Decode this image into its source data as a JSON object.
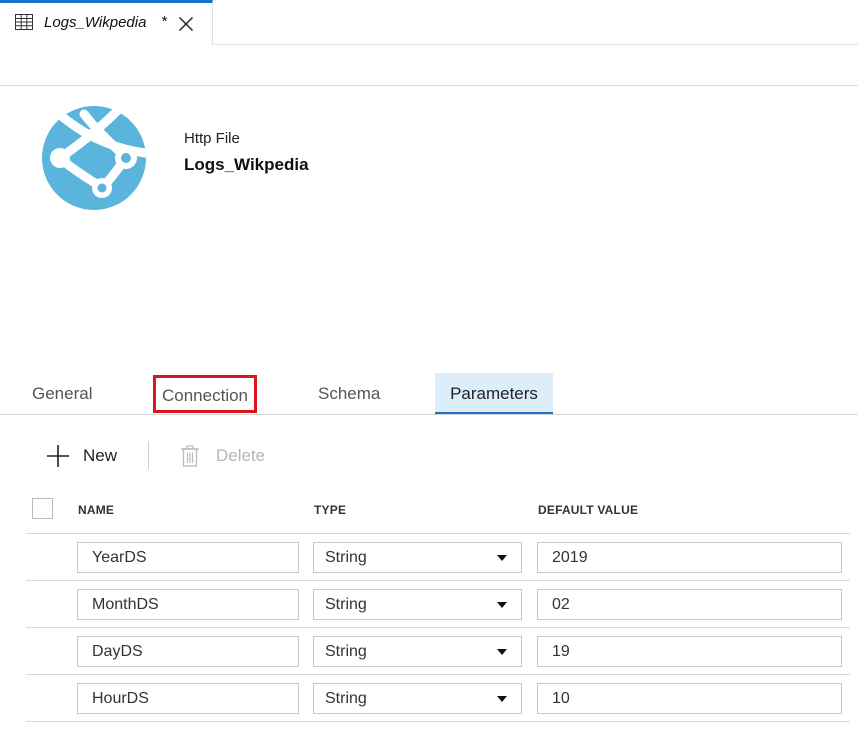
{
  "document_tab": {
    "title": "Logs_Wikpedia",
    "dirty_marker": "*"
  },
  "header": {
    "type_label": "Http File",
    "dataset_name": "Logs_Wikpedia"
  },
  "tabs": [
    {
      "label": "General"
    },
    {
      "label": "Connection"
    },
    {
      "label": "Schema"
    },
    {
      "label": "Parameters"
    }
  ],
  "active_tab": "Parameters",
  "highlighted_tab": "Connection",
  "toolbar": {
    "new_label": "New",
    "delete_label": "Delete"
  },
  "grid": {
    "columns": [
      "NAME",
      "TYPE",
      "DEFAULT VALUE"
    ],
    "rows": [
      {
        "name": "YearDS",
        "type": "String",
        "default": "2019"
      },
      {
        "name": "MonthDS",
        "type": "String",
        "default": "02"
      },
      {
        "name": "DayDS",
        "type": "String",
        "default": "19"
      },
      {
        "name": "HourDS",
        "type": "String",
        "default": "10"
      }
    ]
  },
  "colors": {
    "accent": "#1a73c9",
    "highlight_box": "#d7191f",
    "active_tab_bg": "#ddeefb",
    "logo": "#5ab4dc"
  },
  "icons": {
    "tab": "table-icon",
    "close": "close-icon",
    "logo": "http-linked-service-icon",
    "new": "plus-icon",
    "delete": "trash-icon",
    "dropdown": "chevron-down-icon"
  }
}
